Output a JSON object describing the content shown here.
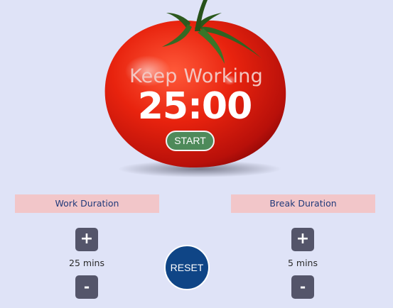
{
  "timer": {
    "status": "Keep Working",
    "display": "25:00",
    "start_label": "START"
  },
  "work": {
    "label": "Work Duration",
    "value": "25 mins",
    "increment_label": "+",
    "decrement_label": "-"
  },
  "break": {
    "label": "Break Duration",
    "value": "5 mins",
    "increment_label": "+",
    "decrement_label": "-"
  },
  "controls": {
    "reset_label": "RESET"
  },
  "colors": {
    "background": "#dfe3f7",
    "tomato": "#e5200c",
    "start_button": "#4e8a5a",
    "reset_button": "#0f4586",
    "label_band": "#f2c6c9",
    "label_text": "#213a7a",
    "stepper": "#54556a"
  }
}
